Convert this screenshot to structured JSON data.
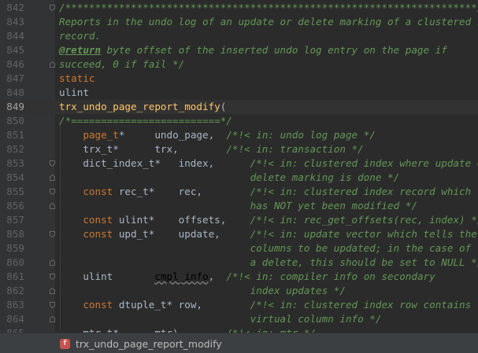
{
  "editor": {
    "current_line": 849,
    "lines": [
      {
        "n": "842",
        "fold": "start",
        "t": [
          [
            "cm",
            "/*********************************************************************//**"
          ]
        ]
      },
      {
        "n": "843",
        "t": [
          [
            "cm",
            "Reports in the undo log of an update or delete marking of a clustered index"
          ]
        ]
      },
      {
        "n": "844",
        "t": [
          [
            "cm",
            "record."
          ]
        ]
      },
      {
        "n": "845",
        "t": [
          [
            "tag",
            "@return"
          ],
          [
            "cm",
            " byte offset of the inserted undo log entry on the page if"
          ]
        ]
      },
      {
        "n": "846",
        "fold": "end",
        "t": [
          [
            "cm",
            "succeed, 0 if fail */"
          ]
        ]
      },
      {
        "n": "847",
        "t": [
          [
            "kw",
            "static"
          ]
        ]
      },
      {
        "n": "848",
        "t": [
          [
            "plain",
            "ulint"
          ]
        ]
      },
      {
        "n": "849",
        "t": [
          [
            "fn",
            "trx_undo_page_report_modify"
          ],
          [
            "plain",
            "("
          ]
        ]
      },
      {
        "n": "850",
        "t": [
          [
            "cm",
            "/*=========================*/"
          ]
        ]
      },
      {
        "n": "851",
        "t": [
          [
            "plain",
            "    "
          ],
          [
            "kw",
            "page_t"
          ],
          [
            "plain",
            "*     undo_page,  "
          ],
          [
            "cm",
            "/*!< in: undo log page */"
          ]
        ]
      },
      {
        "n": "852",
        "t": [
          [
            "plain",
            "    trx_t*      trx,        "
          ],
          [
            "cm",
            "/*!< in: transaction */"
          ]
        ]
      },
      {
        "n": "853",
        "fold": "start",
        "t": [
          [
            "plain",
            "    dict_index_t*   index,      "
          ],
          [
            "cm",
            "/*!< in: clustered index where update or"
          ]
        ]
      },
      {
        "n": "854",
        "fold": "end",
        "t": [
          [
            "cm",
            "                                delete marking is done */"
          ]
        ]
      },
      {
        "n": "855",
        "fold": "start",
        "t": [
          [
            "plain",
            "    "
          ],
          [
            "kw",
            "const"
          ],
          [
            "plain",
            " rec_t*    rec,        "
          ],
          [
            "cm",
            "/*!< in: clustered index record which"
          ]
        ]
      },
      {
        "n": "856",
        "fold": "end",
        "t": [
          [
            "cm",
            "                                has NOT yet been modified */"
          ]
        ]
      },
      {
        "n": "857",
        "t": [
          [
            "plain",
            "    "
          ],
          [
            "kw",
            "const"
          ],
          [
            "plain",
            " ulint*    offsets,    "
          ],
          [
            "cm",
            "/*!< in: rec_get_offsets(rec, index) */"
          ]
        ]
      },
      {
        "n": "858",
        "fold": "start",
        "t": [
          [
            "plain",
            "    "
          ],
          [
            "kw",
            "const"
          ],
          [
            "plain",
            " upd_t*    update,     "
          ],
          [
            "cm",
            "/*!< in: update vector which tells the"
          ]
        ]
      },
      {
        "n": "859",
        "t": [
          [
            "cm",
            "                                columns to be updated; in the case of"
          ]
        ]
      },
      {
        "n": "860",
        "fold": "end",
        "t": [
          [
            "cm",
            "                                a delete, this should be set to NULL */"
          ]
        ]
      },
      {
        "n": "861",
        "fold": "start",
        "t": [
          [
            "plain",
            "    ulint       "
          ],
          [
            "wavy",
            "cmpl_info"
          ],
          [
            "plain",
            ",  "
          ],
          [
            "cm",
            "/*!< in: compiler info on secondary"
          ]
        ]
      },
      {
        "n": "862",
        "fold": "end",
        "t": [
          [
            "cm",
            "                                index updates */"
          ]
        ]
      },
      {
        "n": "863",
        "fold": "start",
        "t": [
          [
            "plain",
            "    "
          ],
          [
            "kw",
            "const"
          ],
          [
            "plain",
            " dtuple_t* row,        "
          ],
          [
            "cm",
            "/*!< in: clustered index row contains"
          ]
        ]
      },
      {
        "n": "864",
        "fold": "end",
        "t": [
          [
            "cm",
            "                                virtual column info */"
          ]
        ]
      },
      {
        "n": "865",
        "t": [
          [
            "plain",
            "    mtr_t*      mtr)        "
          ],
          [
            "cm",
            "/*!< in: mtr */"
          ]
        ]
      }
    ]
  },
  "breadcrumb": {
    "icon_letter": "f",
    "icon": "function-icon",
    "label": "trx_undo_page_report_modify"
  },
  "colors": {
    "background": "#2b2b2b",
    "gutter": "#313335",
    "comment": "#629755",
    "keyword": "#cc7832",
    "function": "#ffc66d",
    "text": "#a9b7c6"
  }
}
